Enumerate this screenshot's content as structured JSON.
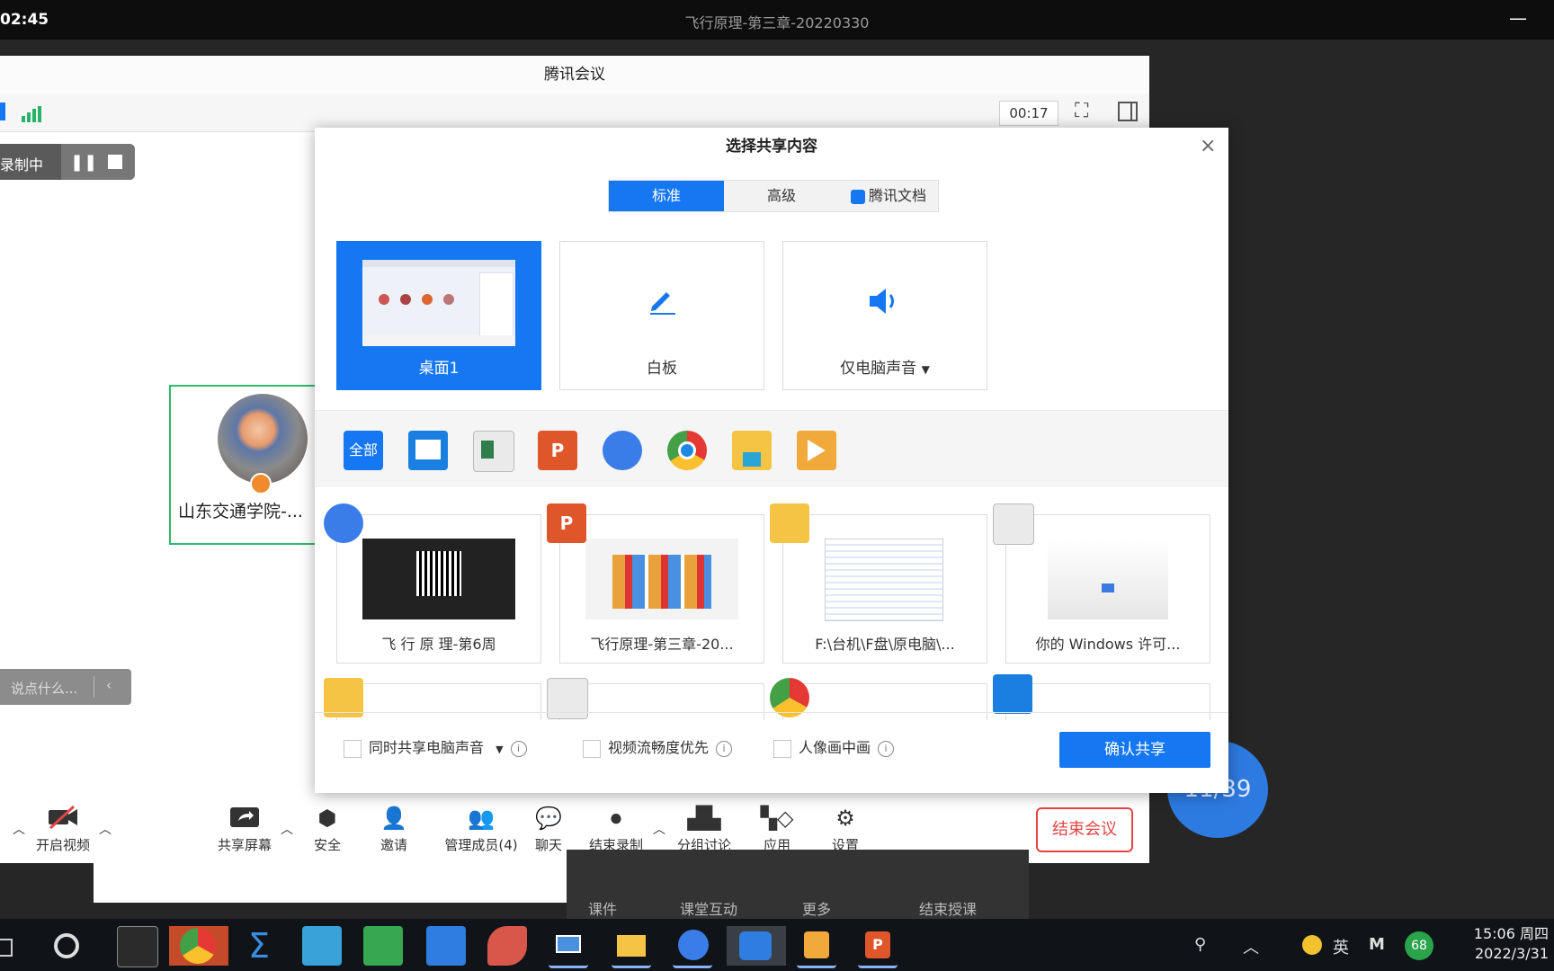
{
  "topbar": {
    "time": "02:45",
    "title": "飞行原理-第三章-20220330",
    "minimize": "—"
  },
  "meeting": {
    "window_title": "腾讯会议",
    "timer": "00:17",
    "recording_label": "录制中",
    "participant_name": "山东交通学院-...",
    "chat_placeholder": "说点什么...",
    "toolbar": {
      "video": "开启视频",
      "share": "共享屏幕",
      "security": "安全",
      "invite": "邀请",
      "members": "管理成员(4)",
      "chat": "聊天",
      "end_record": "结束录制",
      "breakout": "分组讨论",
      "apps": "应用",
      "settings": "设置",
      "end_meeting": "结束会议"
    }
  },
  "lower_bar": {
    "courseware": "课件",
    "interaction": "课堂互动",
    "more": "更多",
    "end_class": "结束授课"
  },
  "page_counter": "11/39",
  "dialog": {
    "title": "选择共享内容",
    "close": "×",
    "tabs": [
      {
        "label": "标准"
      },
      {
        "label": "高级"
      },
      {
        "label": "腾讯文档"
      }
    ],
    "top_cards": [
      {
        "label": "桌面1"
      },
      {
        "label": "白板"
      },
      {
        "label": "仅电脑声音"
      }
    ],
    "filter_all": "全部",
    "windows": [
      {
        "label": "飞 行 原 理-第6周"
      },
      {
        "label": "飞行原理-第三章-20..."
      },
      {
        "label": "F:\\台机\\F盘\\原电脑\\..."
      },
      {
        "label": "你的 Windows 许可..."
      }
    ],
    "options": {
      "share_audio": "同时共享电脑声音",
      "video_priority": "视频流畅度优先",
      "pip": "人像画中画"
    },
    "confirm": "确认共享"
  },
  "taskbar": {
    "ime": "英",
    "clock_time": "15:06 周四",
    "clock_date": "2022/3/31",
    "battery": "68"
  },
  "colors": {
    "accent": "#1677f2",
    "danger": "#e44545",
    "green": "#2dbb6e"
  }
}
